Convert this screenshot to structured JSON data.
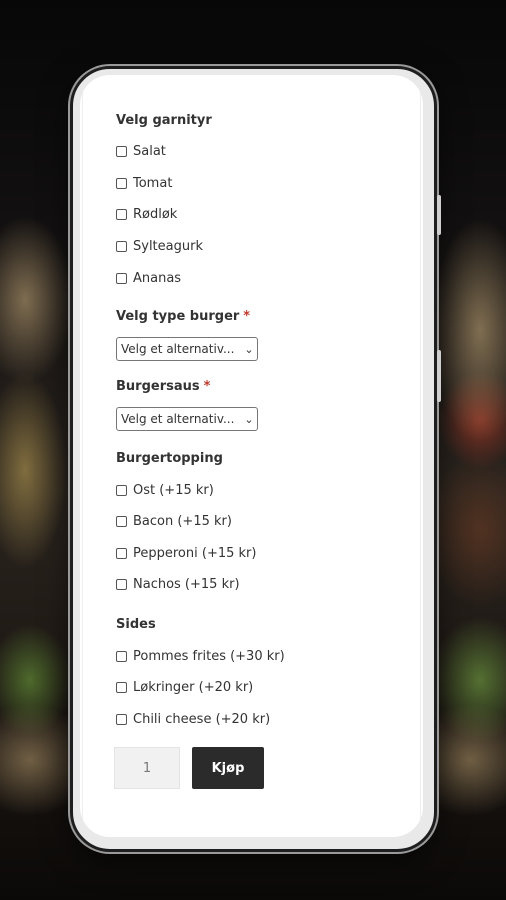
{
  "sections": {
    "garnish": {
      "label": "Velg garnityr",
      "options": [
        "Salat",
        "Tomat",
        "Rødløk",
        "Sylteagurk",
        "Ananas"
      ]
    },
    "burger_type": {
      "label": "Velg type burger",
      "required_mark": "*",
      "selected": "Velg et alternativ..."
    },
    "sauce": {
      "label": "Burgersaus",
      "required_mark": "*",
      "selected": "Velg et alternativ..."
    },
    "topping": {
      "label": "Burgertopping",
      "options": [
        "Ost (+15 kr)",
        "Bacon (+15 kr)",
        "Pepperoni (+15 kr)",
        "Nachos (+15 kr)"
      ]
    },
    "sides": {
      "label": "Sides",
      "options": [
        "Pommes frites (+30 kr)",
        "Løkringer (+20 kr)",
        "Chili cheese (+20 kr)"
      ]
    }
  },
  "purchase": {
    "quantity": "1",
    "buy_label": "Kjøp"
  },
  "icons": {
    "select_chevron": "chevron-down-icon"
  }
}
